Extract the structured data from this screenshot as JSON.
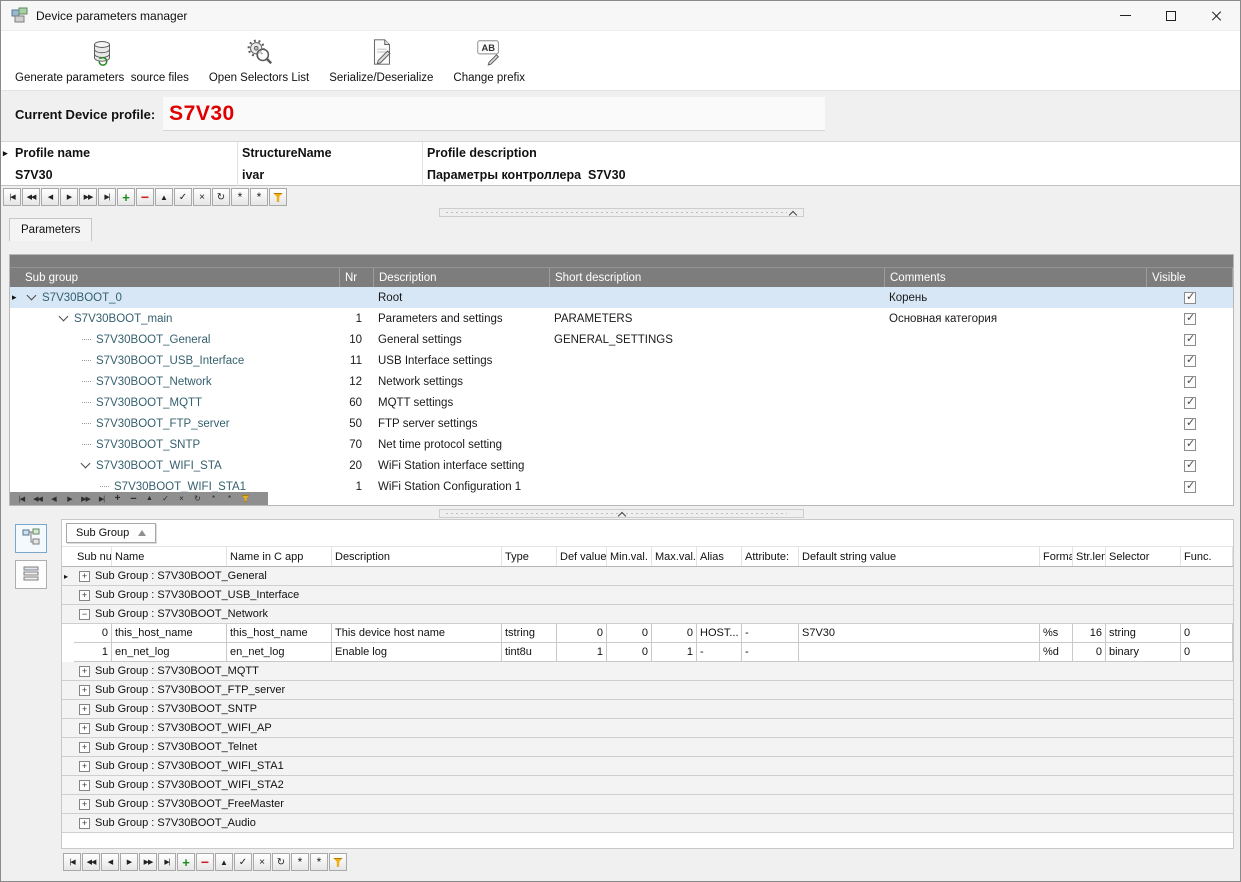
{
  "window": {
    "title": "Device parameters manager"
  },
  "toolbar": {
    "items": [
      {
        "label": "Generate parameters  source files",
        "icon": "database-generate-icon"
      },
      {
        "label": "Open Selectors List",
        "icon": "selectors-gear-icon"
      },
      {
        "label": "Serialize/Deserialize",
        "icon": "serialize-document-icon"
      },
      {
        "label": "Change prefix",
        "icon": "change-prefix-ab-icon"
      }
    ]
  },
  "profile": {
    "label": "Current Device profile:",
    "value": "S7V30",
    "value_color": "#e00000"
  },
  "profileGrid": {
    "columns": [
      "Profile name",
      "StructureName",
      "Profile description"
    ],
    "row": {
      "name": "S7V30",
      "structure": "ivar",
      "description": "Параметры контроллера  S7V30"
    }
  },
  "parametersTab": {
    "label": "Parameters"
  },
  "treeGrid": {
    "columns": [
      "Sub group",
      "Nr",
      "Description",
      "Short description",
      "Comments",
      "Visible"
    ],
    "rows": [
      {
        "level": 1,
        "expander": true,
        "selected": true,
        "name": "S7V30BOOT_0",
        "nr": "",
        "description": "Root",
        "short": "",
        "comments": "Корень",
        "visible": true
      },
      {
        "level": 2,
        "expander": true,
        "name": "S7V30BOOT_main",
        "nr": "1",
        "description": "Parameters and settings",
        "short": "PARAMETERS",
        "comments": "Основная категория",
        "visible": true
      },
      {
        "level": 3,
        "name": "S7V30BOOT_General",
        "nr": "10",
        "description": "General settings",
        "short": "GENERAL_SETTINGS",
        "comments": "",
        "visible": true
      },
      {
        "level": 3,
        "name": "S7V30BOOT_USB_Interface",
        "nr": "11",
        "description": "USB Interface settings",
        "short": "",
        "comments": "",
        "visible": true
      },
      {
        "level": 3,
        "name": "S7V30BOOT_Network",
        "nr": "12",
        "description": "Network settings",
        "short": "",
        "comments": "",
        "visible": true
      },
      {
        "level": 3,
        "name": "S7V30BOOT_MQTT",
        "nr": "60",
        "description": "MQTT settings",
        "short": "",
        "comments": "",
        "visible": true
      },
      {
        "level": 3,
        "name": "S7V30BOOT_FTP_server",
        "nr": "50",
        "description": "FTP server settings",
        "short": "",
        "comments": "",
        "visible": true
      },
      {
        "level": 3,
        "name": "S7V30BOOT_SNTP",
        "nr": "70",
        "description": "Net time protocol setting",
        "short": "",
        "comments": "",
        "visible": true
      },
      {
        "level": 3,
        "expander": true,
        "name": "S7V30BOOT_WIFI_STA",
        "nr": "20",
        "description": "WiFi Station interface setting",
        "short": "",
        "comments": "",
        "visible": true
      },
      {
        "level": 4,
        "name": "S7V30BOOT_WIFI_STA1",
        "nr": "1",
        "description": "WiFi Station Configuration 1",
        "short": "",
        "comments": "",
        "visible": true
      }
    ]
  },
  "paramGrid": {
    "groupBox": "Sub Group",
    "columns": [
      "Sub nur",
      "Name",
      "Name in C app",
      "Description",
      "Type",
      "Def value",
      "Min.val.",
      "Max.val.",
      "Alias",
      "Attribute:",
      "Default string value",
      "Format.s",
      "Str.len.",
      "Selector",
      "Func."
    ],
    "rows": [
      {
        "type": "group",
        "marker": true,
        "expanded": false,
        "label": "Sub Group : S7V30BOOT_General"
      },
      {
        "type": "group",
        "expanded": false,
        "label": "Sub Group : S7V30BOOT_USB_Interface"
      },
      {
        "type": "group",
        "expanded": true,
        "label": "Sub Group : S7V30BOOT_Network"
      },
      {
        "type": "data",
        "cells": [
          "0",
          "this_host_name",
          "this_host_name",
          "This device host name",
          "tstring",
          "0",
          "0",
          "0",
          "HOST...",
          "-",
          "S7V30",
          "%s",
          "16",
          "string",
          "0"
        ]
      },
      {
        "type": "data",
        "cells": [
          "1",
          "en_net_log",
          "en_net_log",
          "Enable log",
          "tint8u",
          "1",
          "0",
          "1",
          "-",
          "-",
          "",
          "%d",
          "0",
          "binary",
          "0"
        ]
      },
      {
        "type": "group",
        "expanded": false,
        "label": "Sub Group : S7V30BOOT_MQTT"
      },
      {
        "type": "group",
        "expanded": false,
        "label": "Sub Group : S7V30BOOT_FTP_server"
      },
      {
        "type": "group",
        "expanded": false,
        "label": "Sub Group : S7V30BOOT_SNTP"
      },
      {
        "type": "group",
        "expanded": false,
        "label": "Sub Group : S7V30BOOT_WIFI_AP"
      },
      {
        "type": "group",
        "expanded": false,
        "label": "Sub Group : S7V30BOOT_Telnet"
      },
      {
        "type": "group",
        "expanded": false,
        "label": "Sub Group : S7V30BOOT_WIFI_STA1"
      },
      {
        "type": "group",
        "expanded": false,
        "label": "Sub Group : S7V30BOOT_WIFI_STA2"
      },
      {
        "type": "group",
        "expanded": false,
        "label": "Sub Group : S7V30BOOT_FreeMaster"
      },
      {
        "type": "group",
        "expanded": false,
        "label": "Sub Group : S7V30BOOT_Audio"
      }
    ]
  },
  "navigator": {
    "buttons": [
      {
        "name": "first",
        "glyph": "|◀"
      },
      {
        "name": "prior-page",
        "glyph": "◀◀"
      },
      {
        "name": "prior",
        "glyph": "◀"
      },
      {
        "name": "next",
        "glyph": "▶"
      },
      {
        "name": "next-page",
        "glyph": "▶▶"
      },
      {
        "name": "last",
        "glyph": "▶|"
      },
      {
        "name": "insert",
        "glyph": "+",
        "cls": "green"
      },
      {
        "name": "delete",
        "glyph": "−",
        "cls": "red"
      },
      {
        "name": "edit",
        "glyph": "▲",
        "cls": "tri"
      },
      {
        "name": "post",
        "glyph": "✓",
        "cls": "op"
      },
      {
        "name": "cancel",
        "glyph": "×",
        "cls": "op"
      },
      {
        "name": "refresh",
        "glyph": "↻",
        "cls": "op"
      },
      {
        "name": "save-bookmark",
        "glyph": "*",
        "cls": "ast"
      },
      {
        "name": "goto-bookmark",
        "glyph": "*",
        "cls": "ast"
      },
      {
        "name": "filter",
        "glyph": "",
        "cls": "filter"
      }
    ]
  },
  "colors": {
    "profile_value_red": "#e00000",
    "insert_green": "#1c8a1c",
    "delete_red": "#cc2020",
    "filter_yellow": "#f2b010",
    "header_gray": "#7d7d7d",
    "selected_row_blue": "#d7e7f6"
  }
}
